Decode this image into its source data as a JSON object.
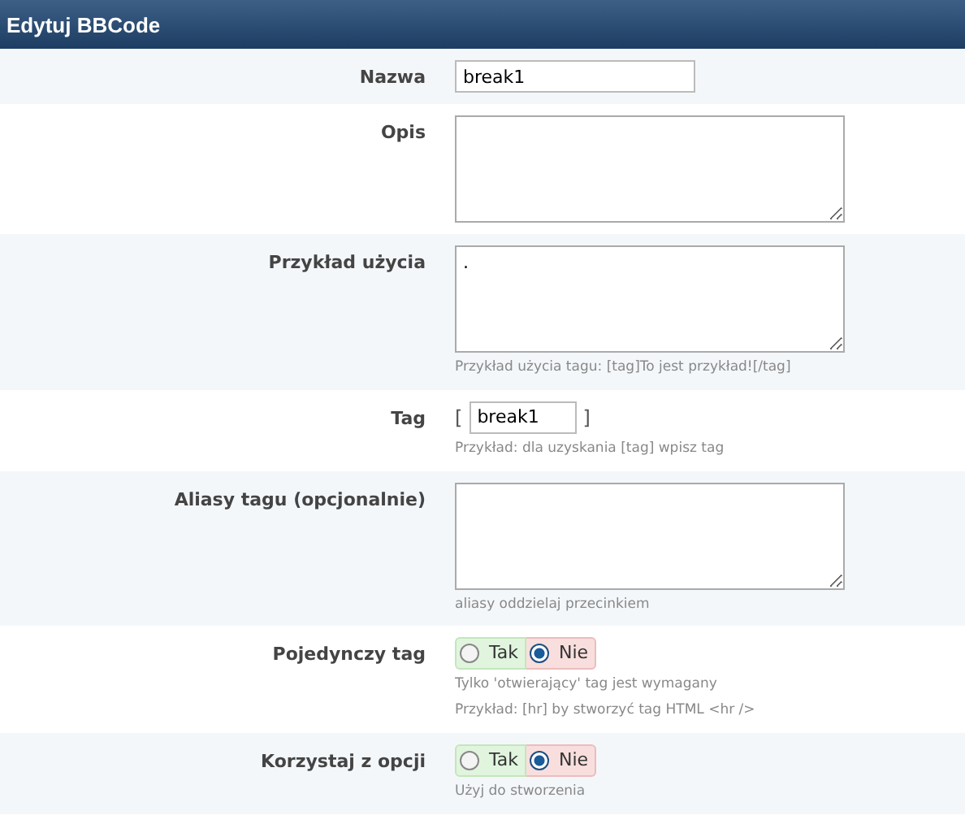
{
  "header": {
    "title": "Edytuj BBCode"
  },
  "rows": [
    {
      "kind": "input",
      "label": "Nazwa",
      "value": "break1"
    },
    {
      "kind": "textarea",
      "label": "Opis"
    },
    {
      "kind": "textarea",
      "label": "Przykład użycia",
      "value": ".",
      "hints": [
        "Przykład użycia tagu: [tag]To jest przykład![/tag]"
      ]
    },
    {
      "kind": "tag",
      "label": "Tag",
      "open": "[",
      "value": "break1",
      "close": "]",
      "hints": [
        "Przykład: dla uzyskania [tag] wpisz tag"
      ]
    },
    {
      "kind": "textarea",
      "label": "Aliasy tagu (opcjonalnie)",
      "hints": [
        "aliasy oddzielaj przecinkiem"
      ]
    },
    {
      "kind": "yesno",
      "label": "Pojedynczy tag",
      "options": [
        {
          "label": "Tak",
          "selected": false
        },
        {
          "label": "Nie",
          "selected": true
        }
      ],
      "hints": [
        "Tylko 'otwierający' tag jest wymagany",
        "Przykład: [hr] by stworzyć tag HTML <hr />"
      ]
    },
    {
      "kind": "yesno",
      "label": "Korzystaj z opcji",
      "options": [
        {
          "label": "Tak",
          "selected": false
        },
        {
          "label": "Nie",
          "selected": true
        }
      ],
      "hints": [
        "Użyj do stworzenia"
      ]
    }
  ]
}
